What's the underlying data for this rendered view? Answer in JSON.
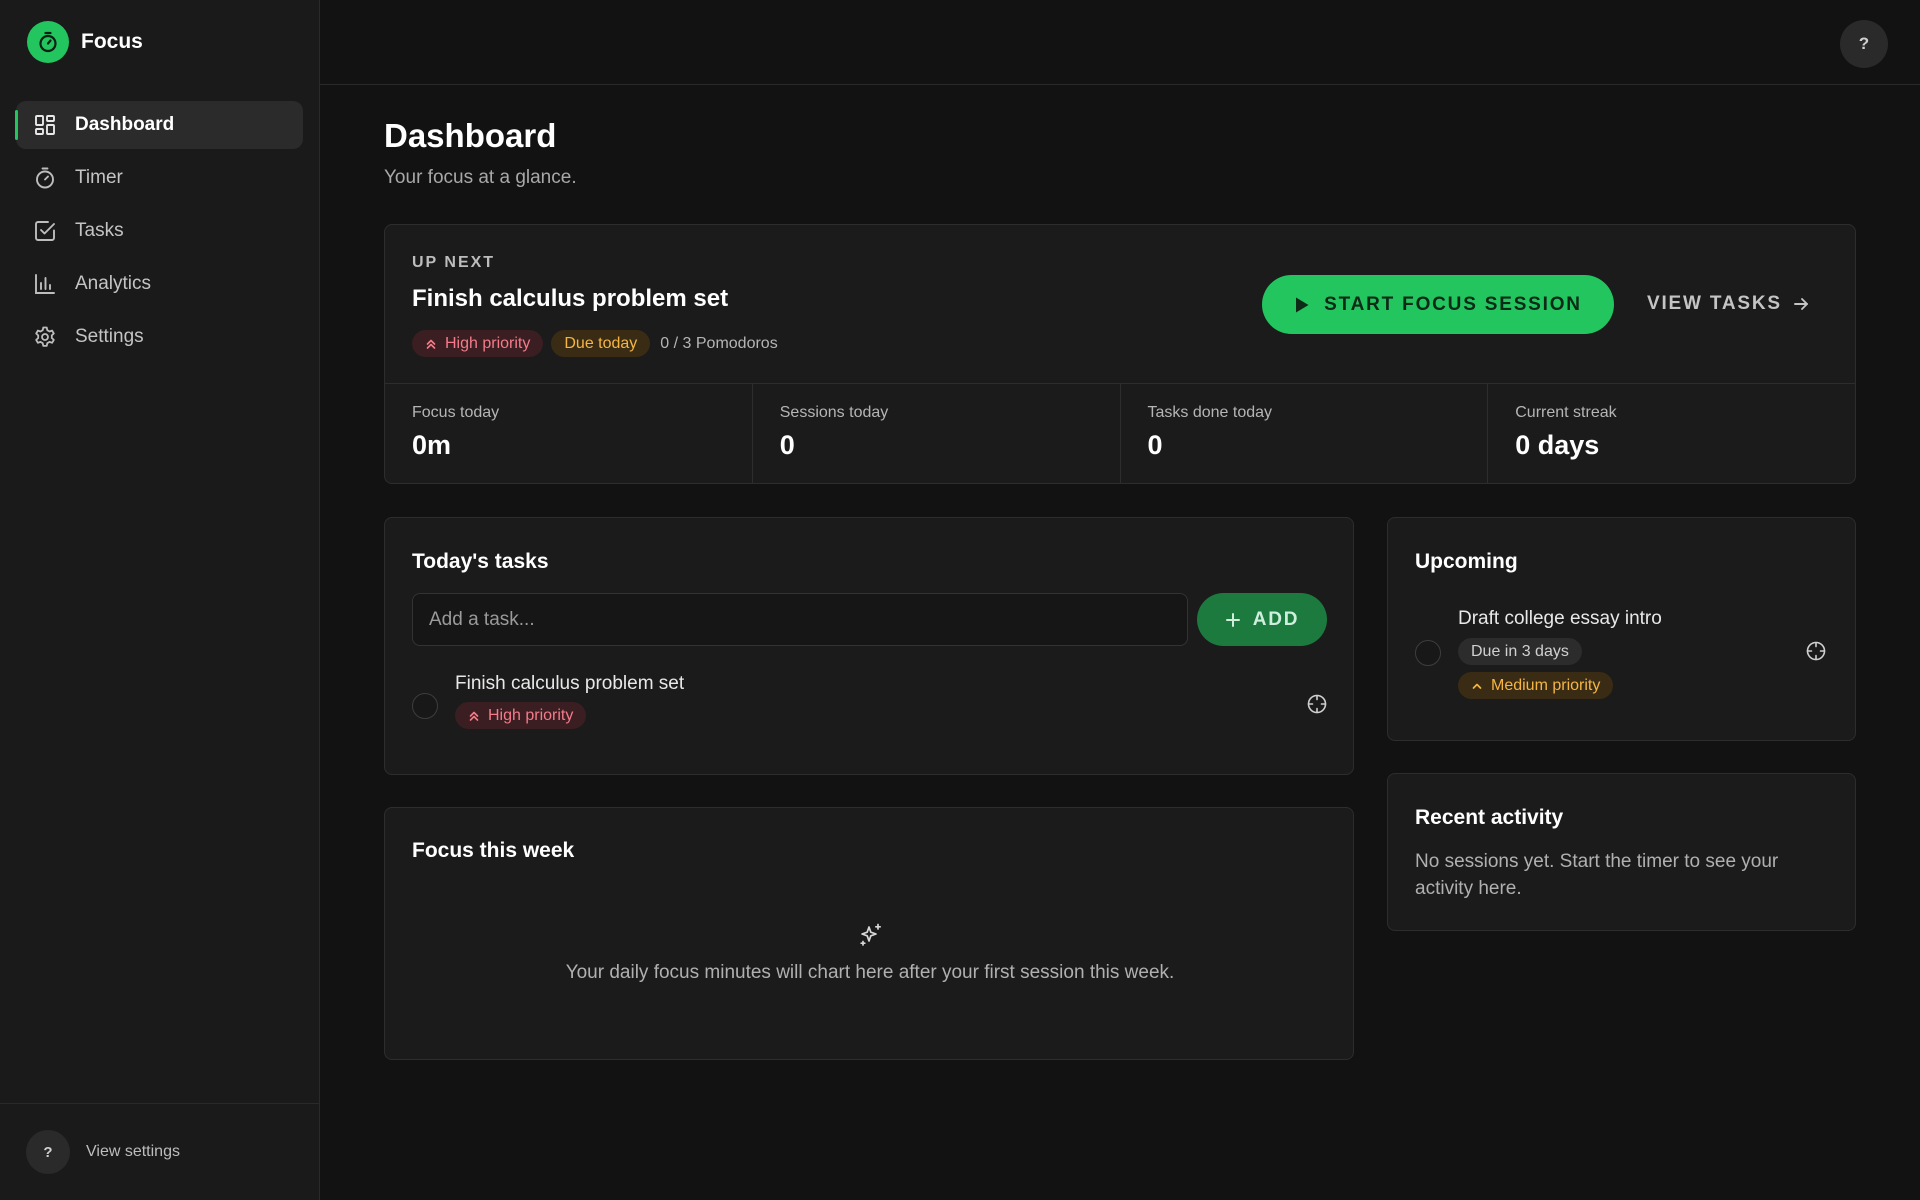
{
  "brand": {
    "name": "Focus",
    "accent": "#22c55e"
  },
  "sidebar": {
    "items": [
      {
        "label": "Dashboard",
        "icon": "dashboard-icon",
        "active": true
      },
      {
        "label": "Timer",
        "icon": "timer-icon",
        "active": false
      },
      {
        "label": "Tasks",
        "icon": "tasks-icon",
        "active": false
      },
      {
        "label": "Analytics",
        "icon": "analytics-icon",
        "active": false
      },
      {
        "label": "Settings",
        "icon": "settings-icon",
        "active": false
      }
    ],
    "footer": {
      "help_glyph": "?",
      "link": "View settings"
    }
  },
  "topbar": {
    "help_glyph": "?"
  },
  "page": {
    "title": "Dashboard",
    "subtitle": "Your focus at a glance."
  },
  "up_next": {
    "eyebrow": "UP NEXT",
    "title": "Finish calculus problem set",
    "priority": "High priority",
    "due": "Due today",
    "pomodoros": "0 / 3 Pomodoros",
    "start_label": "START FOCUS SESSION",
    "view_tasks_label": "VIEW TASKS"
  },
  "stats": [
    {
      "label": "Focus today",
      "value": "0m"
    },
    {
      "label": "Sessions today",
      "value": "0"
    },
    {
      "label": "Tasks done today",
      "value": "0"
    },
    {
      "label": "Current streak",
      "value": "0 days"
    }
  ],
  "todays_tasks": {
    "title": "Today's tasks",
    "input_placeholder": "Add a task...",
    "add_label": "ADD",
    "items": [
      {
        "name": "Finish calculus problem set",
        "priority": "High priority"
      }
    ]
  },
  "focus_week": {
    "title": "Focus this week",
    "empty_text": "Your daily focus minutes will chart here after your first session this week."
  },
  "upcoming": {
    "title": "Upcoming",
    "items": [
      {
        "name": "Draft college essay intro",
        "due": "Due in 3 days",
        "priority": "Medium priority"
      }
    ]
  },
  "recent_activity": {
    "title": "Recent activity",
    "empty_text": "No sessions yet. Start the timer to see your activity here."
  },
  "colors": {
    "background": "#121212",
    "surface": "#1b1b1b",
    "high_priority": "#f47b8a",
    "due_warning": "#f5b544"
  }
}
